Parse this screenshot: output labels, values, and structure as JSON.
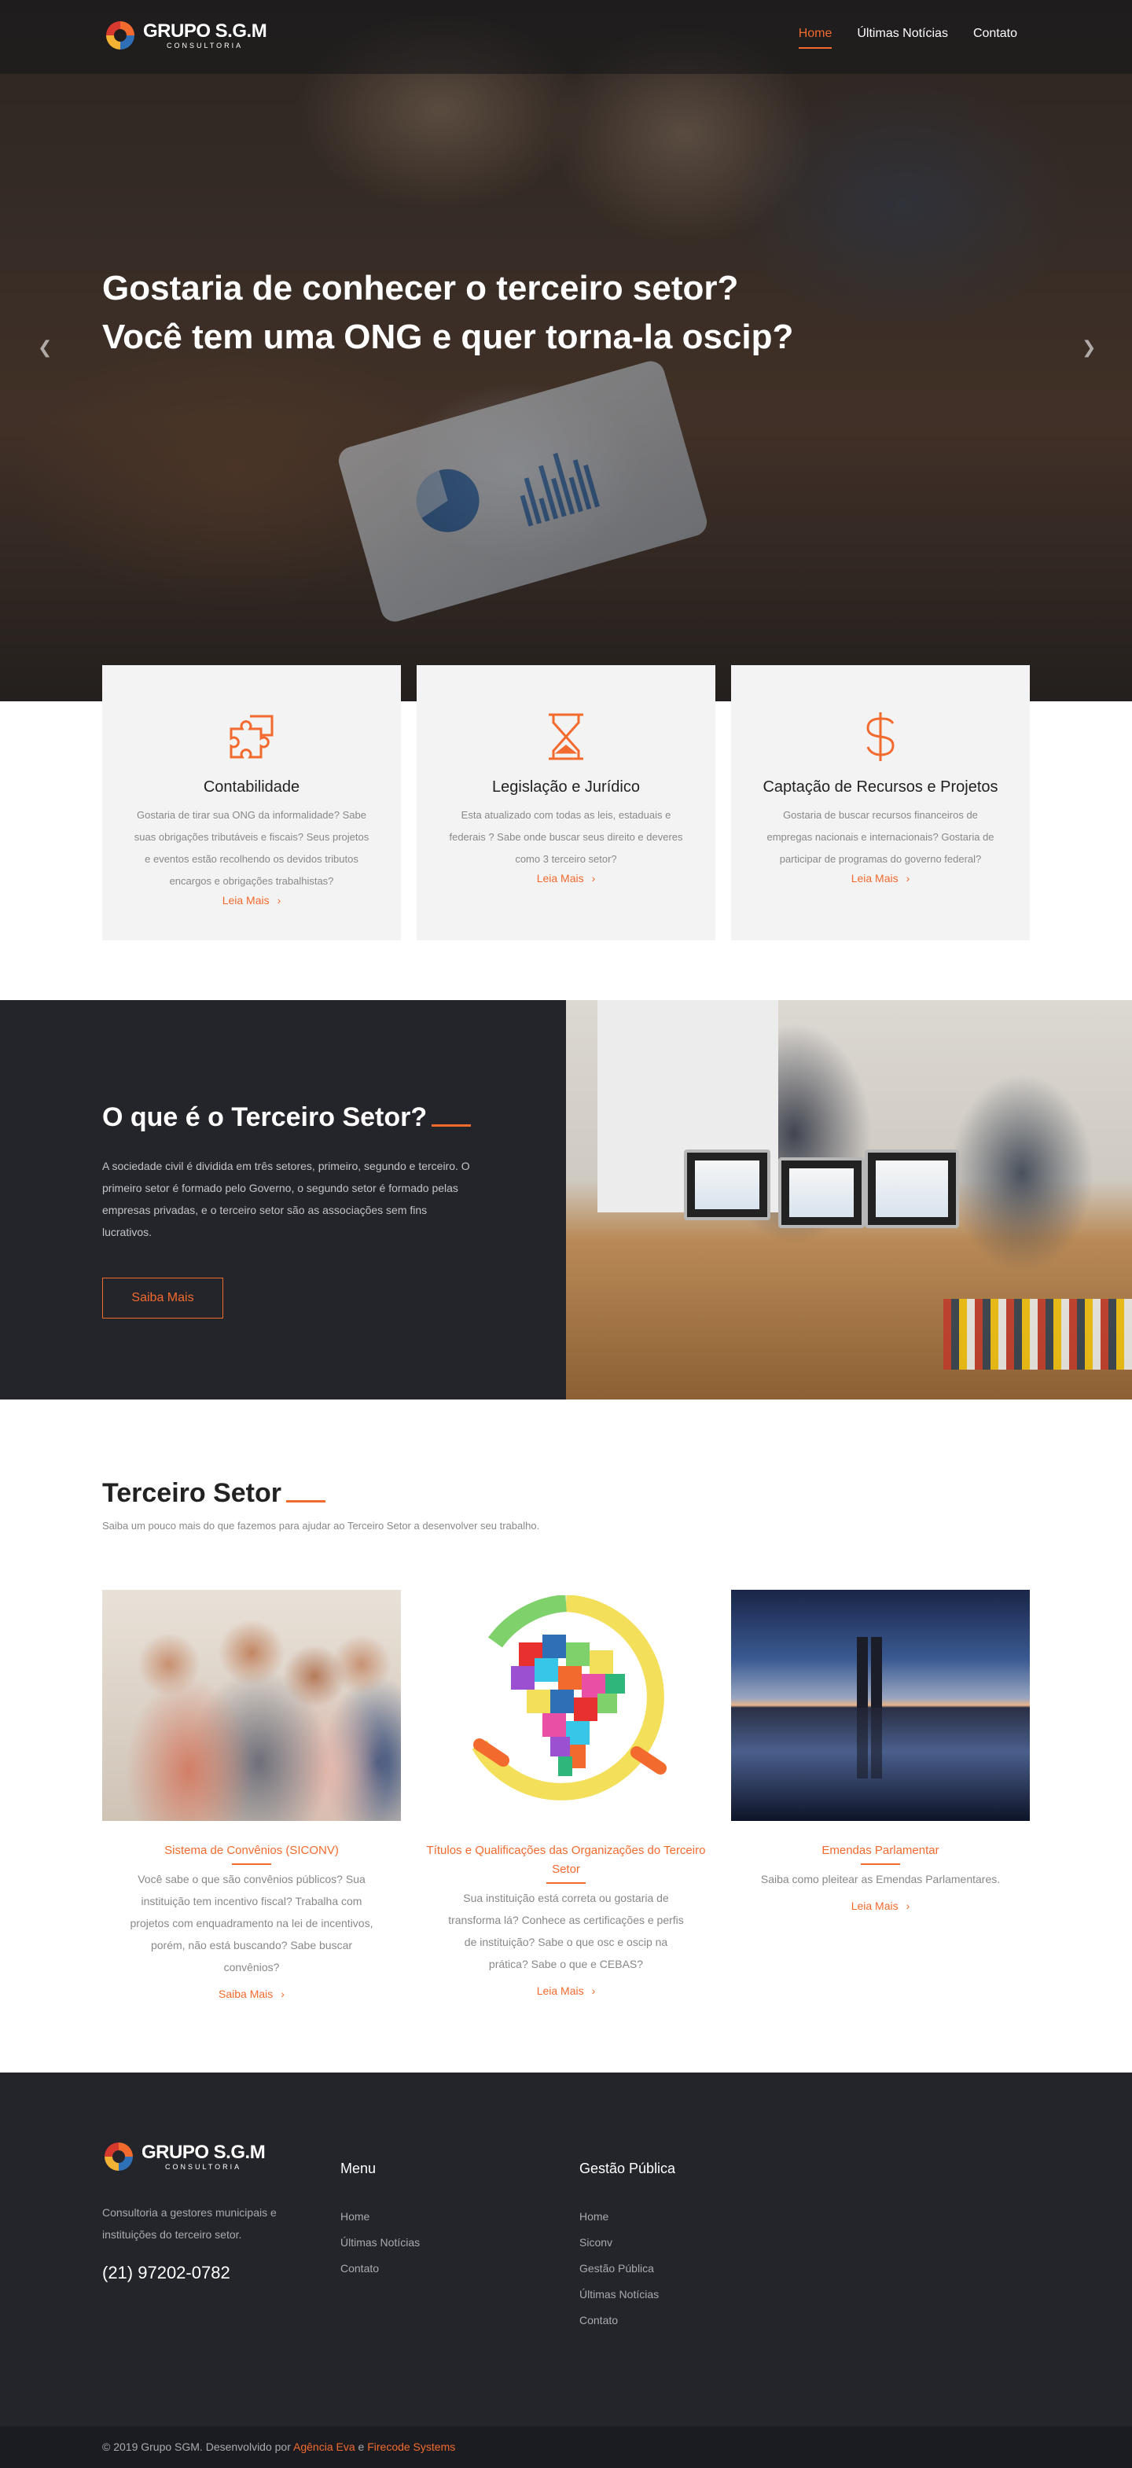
{
  "header": {
    "logo_title": "GRUPO S.G.M",
    "logo_subtitle": "CONSULTORIA",
    "nav": [
      {
        "label": "Home",
        "active": true
      },
      {
        "label": "Últimas Notícias",
        "active": false
      },
      {
        "label": "Contato",
        "active": false
      }
    ]
  },
  "hero": {
    "title_line1": "Gostaria de conhecer o terceiro setor?",
    "title_line2": "Você tem uma ONG e quer torna-la oscip?",
    "prev_icon": "chevron-left-icon",
    "next_icon": "chevron-right-icon"
  },
  "cards": [
    {
      "icon": "puzzle-icon",
      "title": "Contabilidade",
      "text": "Gostaria de tirar sua ONG da informalidade? Sabe suas obrigações tributáveis e fiscais? Seus projetos e eventos estão recolhendo os devidos tributos encargos e obrigações trabalhistas?",
      "link": "Leia Mais"
    },
    {
      "icon": "hourglass-icon",
      "title": "Legislação e Jurídico",
      "text": "Esta atualizado com todas as leis, estaduais e federais ? Sabe onde buscar seus direito e deveres como 3 terceiro setor?",
      "link": "Leia Mais"
    },
    {
      "icon": "dollar-icon",
      "title": "Captação de Recursos e Projetos",
      "text": "Gostaria de buscar recursos financeiros de empregas nacionais e internacionais? Gostaria de participar de programas do governo federal?",
      "link": "Leia Mais"
    }
  ],
  "about": {
    "title": "O que é o Terceiro Setor?",
    "text": "A sociedade civil é dividida em três setores, primeiro, segundo e terceiro. O primeiro setor é formado pelo Governo, o segundo setor é formado pelas empresas privadas, e o terceiro setor são as associações sem fins lucrativos.",
    "button": "Saiba Mais"
  },
  "services": {
    "title": "Terceiro Setor",
    "subtitle": "Saiba um pouco mais do que fazemos para ajudar ao Terceiro Setor a desenvolver seu trabalho.",
    "items": [
      {
        "name": "Sistema de Convênios (SICONV)",
        "text": "Você sabe o que são convênios públicos? Sua instituição tem incentivo fiscal? Trabalha com projetos com enquadramento na lei de incentivos, porém, não está buscando? Sabe buscar convênios?",
        "link": "Saiba Mais"
      },
      {
        "name": "Títulos e Qualificações das Organizações do Terceiro Setor",
        "text": "Sua instituição está correta ou gostaria de transforma lá? Conhece as certificações e perfis de instituição? Sabe o que osc e oscip na prática? Sabe o que e CEBAS?",
        "link": "Leia Mais"
      },
      {
        "name": "Emendas Parlamentar",
        "text": "Saiba como pleitear as Emendas Parlamentares.",
        "link": "Leia Mais"
      }
    ]
  },
  "footer": {
    "description": "Consultoria a gestores municipais e instituições do terceiro setor.",
    "phone": "(21) 97202-0782",
    "menu_title": "Menu",
    "menu": [
      "Home",
      "Últimas Notícias",
      "Contato"
    ],
    "gestao_title": "Gestão Pública",
    "gestao": [
      "Home",
      "Siconv",
      "Gestão Pública",
      "Últimas Notícias",
      "Contato"
    ],
    "copyright_prefix": "© 2019 Grupo SGM. Desenvolvido por",
    "agency": "Agência Eva",
    "and": "e",
    "company": "Firecode Systems"
  },
  "colors": {
    "accent": "#f36a2e",
    "dark": "#24252b",
    "card_bg": "#f3f3f3"
  }
}
